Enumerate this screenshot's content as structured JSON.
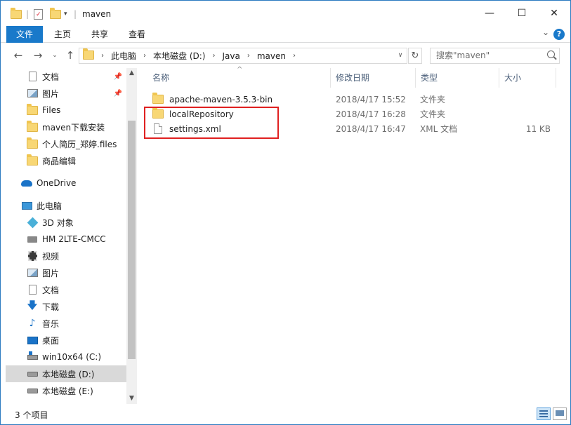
{
  "window": {
    "title": "maven",
    "minimize": "—",
    "maximize": "☐",
    "close": "✕"
  },
  "ribbon": {
    "tabs": [
      "文件",
      "主页",
      "共享",
      "查看"
    ],
    "help": "?"
  },
  "address": {
    "crumbs": [
      "此电脑",
      "本地磁盘 (D:)",
      "Java",
      "maven"
    ],
    "search_placeholder": "搜索\"maven\""
  },
  "nav": {
    "items": [
      {
        "label": "文档",
        "icon": "document-icon",
        "pinned": true
      },
      {
        "label": "图片",
        "icon": "picture-icon",
        "pinned": true
      },
      {
        "label": "Files",
        "icon": "folder-icon"
      },
      {
        "label": "maven下载安装",
        "icon": "folder-icon"
      },
      {
        "label": "个人简历_郑婷.files",
        "icon": "folder-icon"
      },
      {
        "label": "商品编辑",
        "icon": "folder-icon"
      },
      {
        "label": "OneDrive",
        "icon": "onedrive-icon"
      },
      {
        "label": "此电脑",
        "icon": "computer-icon"
      },
      {
        "label": "3D 对象",
        "icon": "3d-objects-icon"
      },
      {
        "label": "HM 2LTE-CMCC",
        "icon": "phone-icon"
      },
      {
        "label": "视频",
        "icon": "video-icon"
      },
      {
        "label": "图片",
        "icon": "picture-icon"
      },
      {
        "label": "文档",
        "icon": "document-icon"
      },
      {
        "label": "下载",
        "icon": "download-icon"
      },
      {
        "label": "音乐",
        "icon": "music-icon"
      },
      {
        "label": "桌面",
        "icon": "desktop-icon"
      },
      {
        "label": "win10x64 (C:)",
        "icon": "system-drive-icon"
      },
      {
        "label": "本地磁盘 (D:)",
        "icon": "drive-icon",
        "selected": true
      },
      {
        "label": "本地磁盘 (E:)",
        "icon": "drive-icon"
      }
    ]
  },
  "columns": {
    "name": "名称",
    "date": "修改日期",
    "type": "类型",
    "size": "大小"
  },
  "files": [
    {
      "name": "apache-maven-3.5.3-bin",
      "date": "2018/4/17 15:52",
      "type": "文件夹",
      "size": "",
      "icon": "folder-icon"
    },
    {
      "name": "localRepository",
      "date": "2018/4/17 16:28",
      "type": "文件夹",
      "size": "",
      "icon": "folder-icon"
    },
    {
      "name": "settings.xml",
      "date": "2018/4/17 16:47",
      "type": "XML 文档",
      "size": "11 KB",
      "icon": "xml-file-icon"
    }
  ],
  "status": {
    "item_count": "3 个项目"
  },
  "colors": {
    "accent": "#1979ca",
    "highlight_box": "#e02020",
    "folder": "#f8d775"
  }
}
